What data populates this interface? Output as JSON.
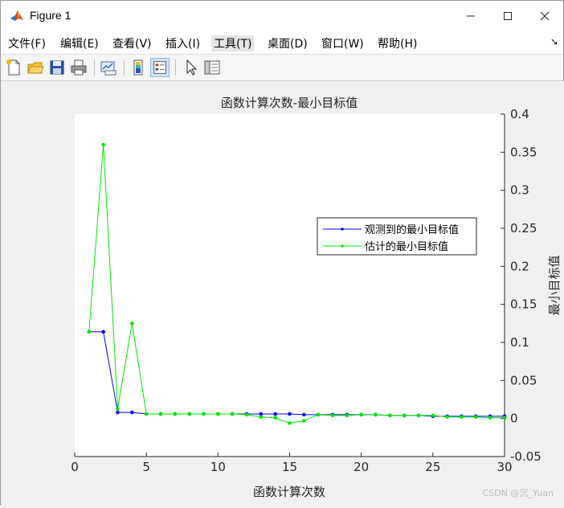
{
  "window": {
    "title": "Figure 1"
  },
  "menu": [
    "文件(F)",
    "编辑(E)",
    "查看(V)",
    "插入(I)",
    "工具(T)",
    "桌面(D)",
    "窗口(W)",
    "帮助(H)"
  ],
  "toolbar_icons": [
    "new-figure-icon",
    "open-file-icon",
    "save-icon",
    "print-icon",
    "link-plot-icon",
    "insert-colorbar-icon",
    "insert-legend-icon",
    "edit-plot-pointer-icon",
    "property-inspector-icon"
  ],
  "colors": {
    "observed": "#0000ff",
    "estimated": "#00e600",
    "plot_bg": "#ffffff",
    "figure_bg": "#f0f0f0"
  },
  "watermark": "CSDN @沉_Yuan",
  "chart_data": {
    "type": "line",
    "title": "函数计算次数-最小目标值",
    "xlabel": "函数计算次数",
    "ylabel": "最小目标值",
    "xlim": [
      0,
      30
    ],
    "ylim": [
      -0.05,
      0.4
    ],
    "xticks": [
      "0",
      "5",
      "10",
      "15",
      "20",
      "25",
      "30"
    ],
    "yticks": [
      "-0.05",
      "0",
      "0.05",
      "0.1",
      "0.15",
      "0.2",
      "0.25",
      "0.3",
      "0.35",
      "0.4"
    ],
    "x_axis_location": "bottom",
    "y_axis_location": "right",
    "grid": false,
    "legend_location": "right",
    "series": [
      {
        "name": "观测到的最小目标值",
        "color": "#0000ff",
        "x": [
          1,
          2,
          3,
          4,
          5,
          6,
          7,
          8,
          9,
          10,
          11,
          12,
          13,
          14,
          15,
          16,
          17,
          18,
          19,
          20,
          21,
          22,
          23,
          24,
          25,
          26,
          27,
          28,
          29,
          30
        ],
        "values": [
          0.114,
          0.114,
          0.008,
          0.008,
          0.006,
          0.006,
          0.006,
          0.006,
          0.006,
          0.006,
          0.006,
          0.006,
          0.006,
          0.006,
          0.006,
          0.005,
          0.005,
          0.005,
          0.005,
          0.005,
          0.005,
          0.004,
          0.004,
          0.004,
          0.003,
          0.003,
          0.003,
          0.003,
          0.003,
          0.003
        ]
      },
      {
        "name": "估计的最小目标值",
        "color": "#00e600",
        "x": [
          1,
          2,
          3,
          4,
          5,
          6,
          7,
          8,
          9,
          10,
          11,
          12,
          13,
          14,
          15,
          16,
          17,
          18,
          19,
          20,
          21,
          22,
          23,
          24,
          25,
          26,
          27,
          28,
          29,
          30
        ],
        "values": [
          0.114,
          0.36,
          0.013,
          0.125,
          0.006,
          0.006,
          0.006,
          0.006,
          0.006,
          0.006,
          0.006,
          0.005,
          0.002,
          0.001,
          -0.006,
          -0.003,
          0.005,
          0.004,
          0.004,
          0.005,
          0.005,
          0.004,
          0.004,
          0.004,
          0.004,
          0.002,
          0.002,
          0.002,
          0.001,
          0.001
        ]
      }
    ]
  }
}
